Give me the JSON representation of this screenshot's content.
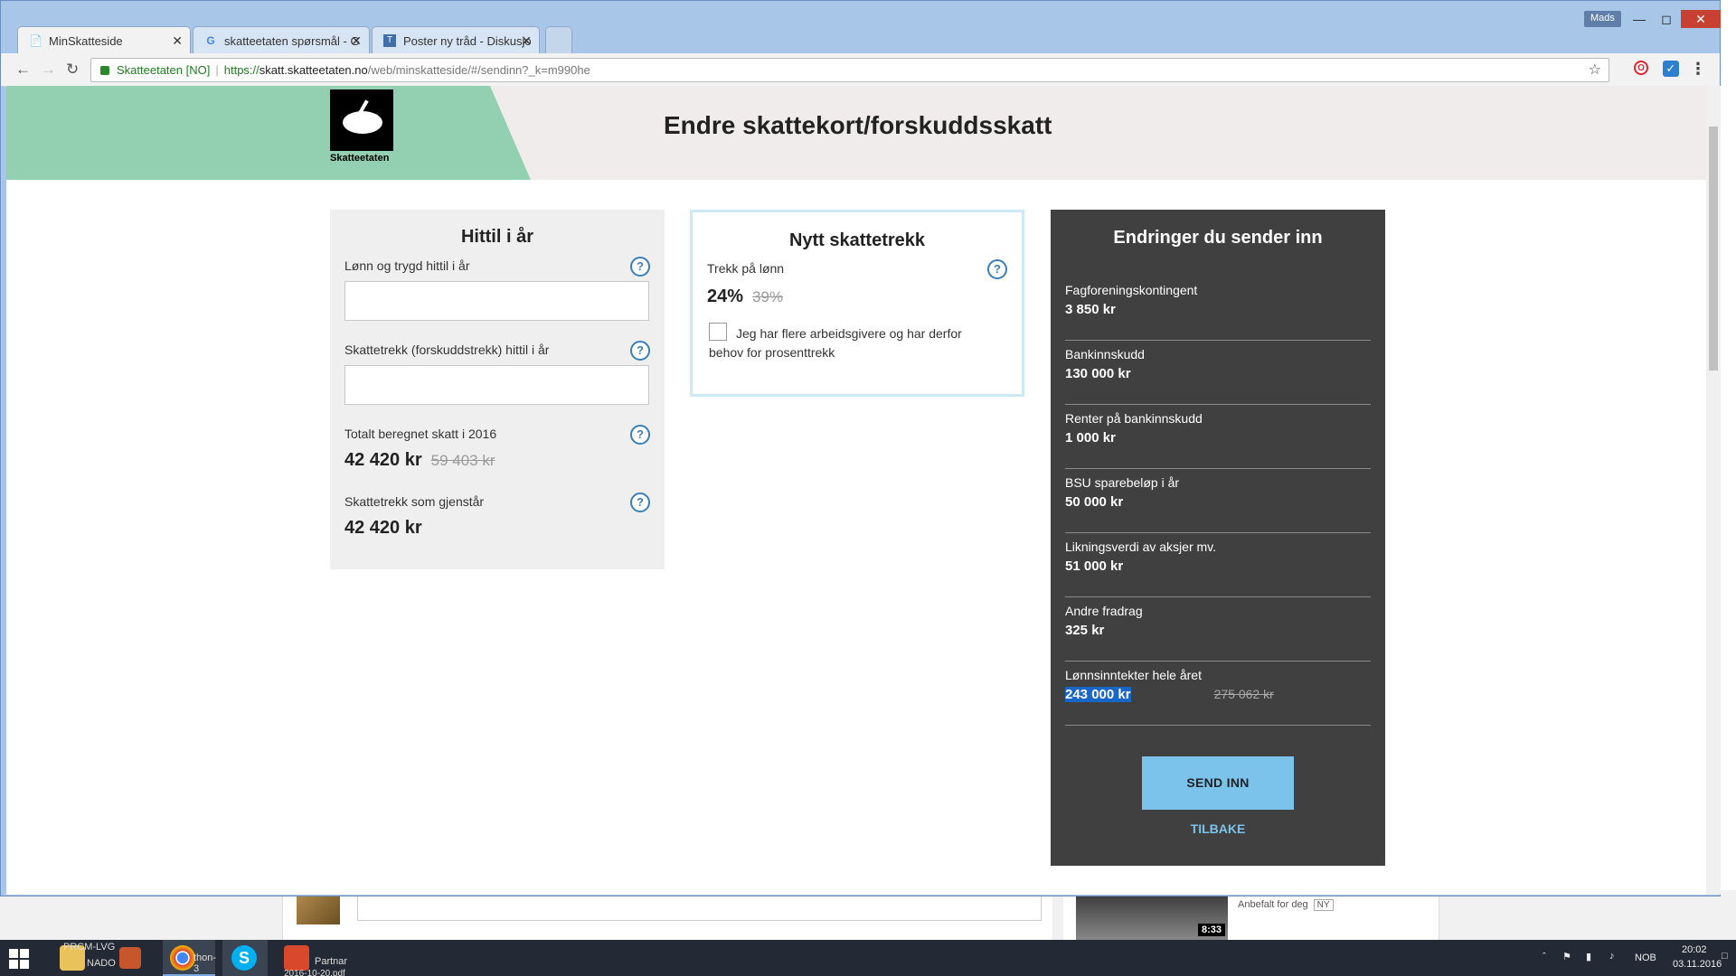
{
  "browser": {
    "tabs": [
      {
        "label": "MinSkatteside",
        "icon": "page-icon"
      },
      {
        "label": "skatteetaten spørsmål - G",
        "icon": "google-icon"
      },
      {
        "label": "Poster ny tråd - Diskusjo",
        "icon": "forum-icon"
      }
    ],
    "user": "Mads",
    "address": {
      "secure_label": "Skatteetaten [NO]",
      "scheme": "https://",
      "host": "skatt.skatteetaten.no",
      "path": "/web/minskatteside/#/sendinn?_k=m990he"
    }
  },
  "header": {
    "logo_text": "Skatteetaten",
    "title": "Endre skattekort/forskuddsskatt"
  },
  "left_panel": {
    "title": "Hittil i år",
    "salary_label": "Lønn og trygd hittil i år",
    "withheld_label": "Skattetrekk (forskuddstrekk) hittil i år",
    "total_tax_label": "Totalt beregnet skatt i 2016",
    "total_tax_value": "42 420 kr",
    "total_tax_old": "59 403 kr",
    "remaining_label": "Skattetrekk som gjenstår",
    "remaining_value": "42 420 kr",
    "help": "?"
  },
  "mid_panel": {
    "title": "Nytt skattetrekk",
    "rate_label": "Trekk på lønn",
    "rate_value": "24%",
    "rate_old": "39%",
    "checkbox_label": "Jeg har flere arbeidsgivere og har derfor behov for prosenttrekk"
  },
  "right_panel": {
    "title": "Endringer du sender inn",
    "items": [
      {
        "label": "Fagforeningskontingent",
        "value": "3 850 kr"
      },
      {
        "label": "Bankinnskudd",
        "value": "130 000 kr"
      },
      {
        "label": "Renter på bankinnskudd",
        "value": "1 000 kr"
      },
      {
        "label": "BSU sparebeløp i år",
        "value": "50 000 kr"
      },
      {
        "label": "Likningsverdi av aksjer mv.",
        "value": "51 000 kr"
      },
      {
        "label": "Andre fradrag",
        "value": "325 kr"
      },
      {
        "label": "Lønnsinntekter hele året",
        "value": "243 000 kr",
        "old": "275 062 kr"
      }
    ],
    "send_label": "SEND INN",
    "back_label": "TILBAKE"
  },
  "background_page": {
    "video_duration": "8:33",
    "recommended": "Anbefalt for deg",
    "new_badge": "NY"
  },
  "taskbar": {
    "item1_top": "PRCM-LVG",
    "item1_bottom": "NADO",
    "item2": "thon-3",
    "item3_top": "Partnar",
    "item3_bottom": "2016-10-20.pdf",
    "language": "NOB",
    "time": "20:02",
    "date": "03.11.2016"
  },
  "colors": {
    "header_green": "#93d0b1",
    "header_bg": "#f1ecec",
    "dark_panel": "#404040",
    "accent_blue": "#7cc3ec",
    "help_blue": "#3b7fb8",
    "selection": "#1866c7"
  }
}
